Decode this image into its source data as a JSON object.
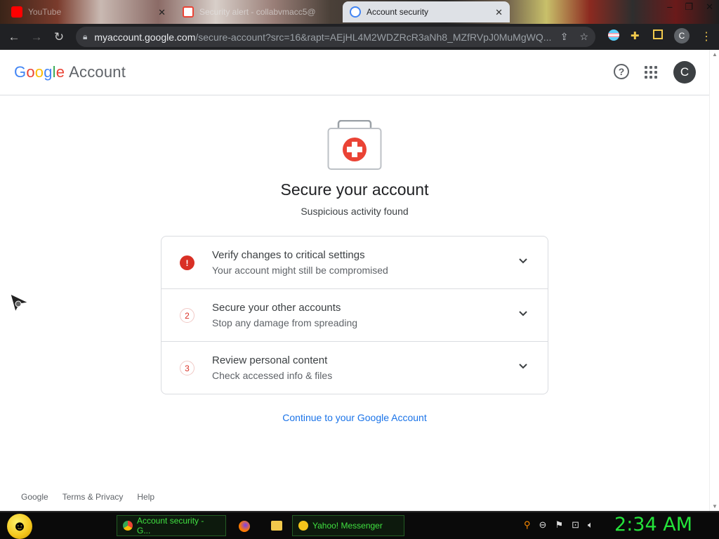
{
  "browser": {
    "tabs": [
      {
        "label": "YouTube",
        "active": false
      },
      {
        "label": "Security alert - collabvmacc5@",
        "active": false
      },
      {
        "label": "Account security",
        "active": true
      }
    ],
    "url_host": "myaccount.google.com",
    "url_path": "/secure-account?src=16&rapt=AEjHL4M2WDZRcR3aNh8_MZfRVpJ0MuMgWQ...",
    "profile_initial": "C"
  },
  "header": {
    "logo_google": [
      "G",
      "o",
      "o",
      "g",
      "l",
      "e"
    ],
    "logo_account": "Account",
    "avatar_initial": "C"
  },
  "main": {
    "title": "Secure your account",
    "subtitle": "Suspicious activity found",
    "items": [
      {
        "marker": "!",
        "title": "Verify changes to critical settings",
        "subtitle": "Your account might still be compromised"
      },
      {
        "marker": "2",
        "title": "Secure your other accounts",
        "subtitle": "Stop any damage from spreading"
      },
      {
        "marker": "3",
        "title": "Review personal content",
        "subtitle": "Check accessed info & files"
      }
    ],
    "continue_link": "Continue to your Google Account"
  },
  "footer": {
    "links": [
      "Google",
      "Terms & Privacy",
      "Help"
    ]
  },
  "taskbar": {
    "tasks": [
      {
        "label": "Account security - G..."
      },
      {
        "label": "Yahoo! Messenger"
      }
    ],
    "clock": "2:34 AM"
  },
  "colors": {
    "accent_blue": "#1a73e8",
    "alert_red": "#d93025",
    "clock_green": "#24e33a"
  }
}
